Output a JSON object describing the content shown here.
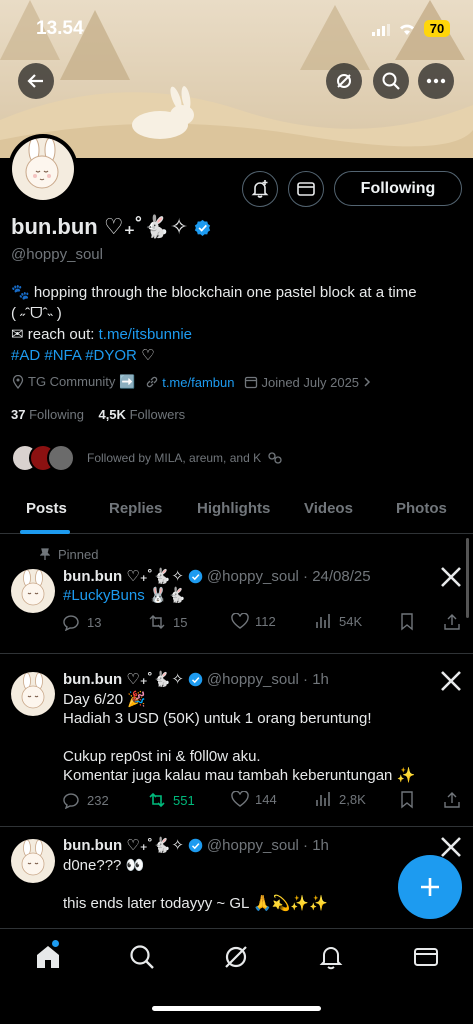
{
  "status_bar": {
    "time": "13.54",
    "battery": "70"
  },
  "profile": {
    "name": "bun.bun ♡₊˚🐇✧",
    "handle": "@hoppy_soul",
    "follow_label": "Following",
    "bio_line1": "🐾 hopping through the blockchain one pastel block at a time",
    "bio_line2": "( ˶ˆᗜˆ˵ )",
    "bio_line3_prefix": "✉ reach out: ",
    "bio_line3_link": "t.me/itsbunnie",
    "bio_hashtags": "#AD #NFA #DYOR",
    "bio_heart": "♡",
    "location": "TG Community ➡️",
    "website": "t.me/fambun",
    "joined": "Joined July 2025",
    "following_count": "37",
    "following_label": "Following",
    "followers_count": "4,5K",
    "followers_label": "Followers",
    "followed_by": "Followed by MILA, areum, and K"
  },
  "tabs": [
    "Posts",
    "Replies",
    "Highlights",
    "Videos",
    "Photos"
  ],
  "pinned_label": "Pinned",
  "posts": [
    {
      "name": "bun.bun ♡₊˚🐇✧",
      "handle_time": "@hoppy_soul · 24/08/25",
      "text1": "#LuckyBuns 🐰🐇",
      "replies": "13",
      "reposts": "15",
      "likes": "112",
      "views": "54K"
    },
    {
      "name": "bun.bun ♡₊˚🐇✧",
      "handle_time": "@hoppy_soul · 1h",
      "text1": "Day 6/20 🎉",
      "text2": "Hadiah 3 USD (50K) untuk 1 orang beruntung!",
      "text3": "Cukup rep0st ini & f0ll0w aku.",
      "text4": "Komentar juga kalau mau tambah keberuntungan ✨",
      "replies": "232",
      "reposts": "551",
      "likes": "144",
      "views": "2,8K"
    },
    {
      "name": "bun.bun ♡₊˚🐇✧",
      "handle_time": "@hoppy_soul · 1h",
      "text1": "d0ne??? 👀",
      "text2": "this ends later todayyy ~ GL 🙏💫✨✨"
    }
  ],
  "colors": {
    "accent": "#1d9bf0",
    "repost_active": "#00ba7c",
    "muted": "#71767b"
  }
}
